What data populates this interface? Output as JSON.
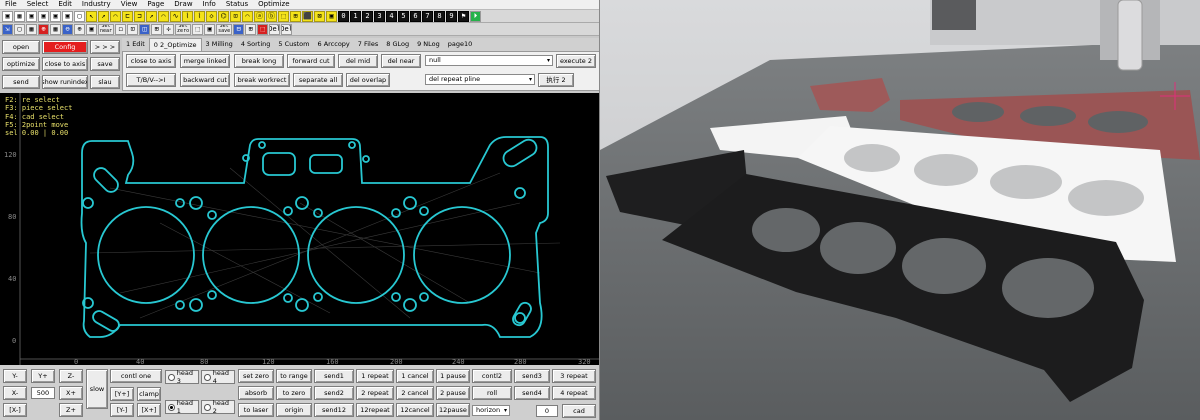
{
  "menu": [
    "File",
    "Select",
    "Edit",
    "Industry",
    "View",
    "Page",
    "Draw",
    "Info",
    "Status",
    "Optimize"
  ],
  "toolbar1": [
    "▣",
    "▦",
    "▣",
    "▣",
    "▣",
    "▣",
    "▢",
    "↖",
    "↗",
    "⌒",
    "⊏",
    "⊐",
    "↗",
    "⌒",
    "∿",
    "⌇",
    "⌇",
    "◇",
    "⌬",
    "⊡",
    "⌒",
    "ⓐ",
    "ⓑ",
    "⬚",
    "⊞",
    "⬛",
    "⊠",
    "▣",
    "0",
    "1",
    "2",
    "3",
    "4",
    "5",
    "6",
    "7",
    "8",
    "9",
    "⚑",
    "⏵"
  ],
  "toolbar2": [
    "⇲",
    "▢",
    "▦",
    "⊕",
    "▦",
    "⊖",
    "⊕",
    "▣",
    "◻",
    "⊡",
    "◫",
    "⊞",
    "✢",
    "⬚",
    "▣",
    "⊟",
    "⊞",
    "⬚",
    "Del",
    "Del"
  ],
  "toolbar2_labels": [
    "Set\nnear",
    "Set\nzero",
    "Set\nsave"
  ],
  "left_buttons": {
    "open": "open",
    "config": "Config",
    "arrows": "> > >",
    "optimize": "optimize",
    "close_to_axis": "close to axis",
    "save": "save",
    "send": "send",
    "show_runindex": "show runindex",
    "slau": "slau"
  },
  "tabs": [
    "1 Edit",
    "0 2_Optimize",
    "3 Milling",
    "4 Sorting",
    "5 Custom",
    "6 Arccopy",
    "7 Files",
    "8 GLog",
    "9 NLog",
    "page10"
  ],
  "optimize": {
    "row1": [
      "close to axis",
      "merge linked",
      "break long",
      "forward cut",
      "del mid",
      "del near"
    ],
    "row2": [
      "T/B/V-->I",
      "backward cut",
      "break workrect",
      "separate all",
      "del overlap"
    ],
    "select1": "null",
    "execute2": "execute 2",
    "select2": "del repeat pline",
    "execute_cn": "执行 2"
  },
  "status_lines": [
    "F2: re select",
    "F3: piece select",
    "F4: cad select",
    "F5: 2point move",
    "sel 0.00 | 0.00"
  ],
  "axis": {
    "x_ticks": [
      "0",
      "40",
      "80",
      "120",
      "160",
      "200",
      "240",
      "280",
      "320"
    ],
    "y_ticks": [
      "120",
      "80",
      "40",
      "0"
    ]
  },
  "bottom": {
    "jog": [
      "Y-",
      "Y+",
      "Z-",
      "X-",
      "500",
      "X+",
      "Z+",
      "slow"
    ],
    "bracket": [
      "[X-]",
      "[Y-]",
      "[X+]",
      "[Y+]"
    ],
    "ctrl": [
      "contl one",
      "clamp"
    ],
    "heads": [
      "head 3",
      "head 4",
      "head 1",
      "head 2"
    ],
    "grid": [
      [
        "set zero",
        "to range",
        "send1",
        "1 repeat",
        "1 cancel",
        "1 pause",
        "contl2",
        "send3",
        "3 repeat"
      ],
      [
        "absorb",
        "to zero",
        "send2",
        "2 repeat",
        "2 cancel",
        "2 pause",
        "roll",
        "send4",
        "4 repeat"
      ],
      [
        "to laser",
        "origin",
        "send12",
        "12repeat",
        "12cancel",
        "12pause"
      ]
    ],
    "horizon": "horizon",
    "zero_value": "0",
    "cad": "cad"
  },
  "colors": {
    "gasket_outline": "#28c8d2",
    "canvas_bg": "#000000",
    "status_text": "#e8e06a",
    "config_red": "#e41e1e"
  }
}
